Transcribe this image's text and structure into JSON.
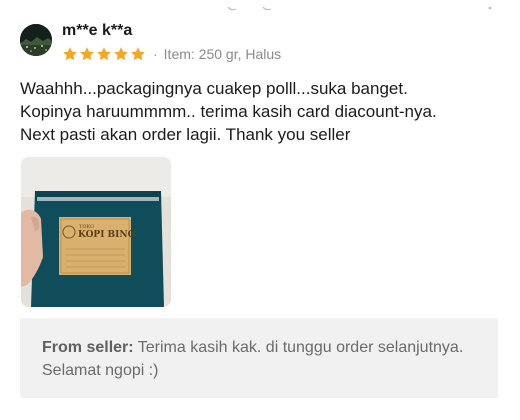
{
  "review": {
    "reviewer_name": "m**e k**a",
    "rating": 5,
    "rating_max": 5,
    "separator": "·",
    "variant": "Item: 250 gr, Halus",
    "text_lines": [
      "Waahhh...packagingnya cuakep polll...suka banget.",
      "Kopinya haruummmm.. terima kasih card diacount-nya.",
      "Next pasti akan order lagii. Thank you seller"
    ],
    "photo": {
      "label_brand_small": "TOKO",
      "label_brand": "KOPI BING"
    },
    "star_color": "#f5a623"
  },
  "seller_reply": {
    "label": "From seller:",
    "text": " Terima kasih kak. di tunggu order selanjutnya. Selamat ngopi :)"
  }
}
